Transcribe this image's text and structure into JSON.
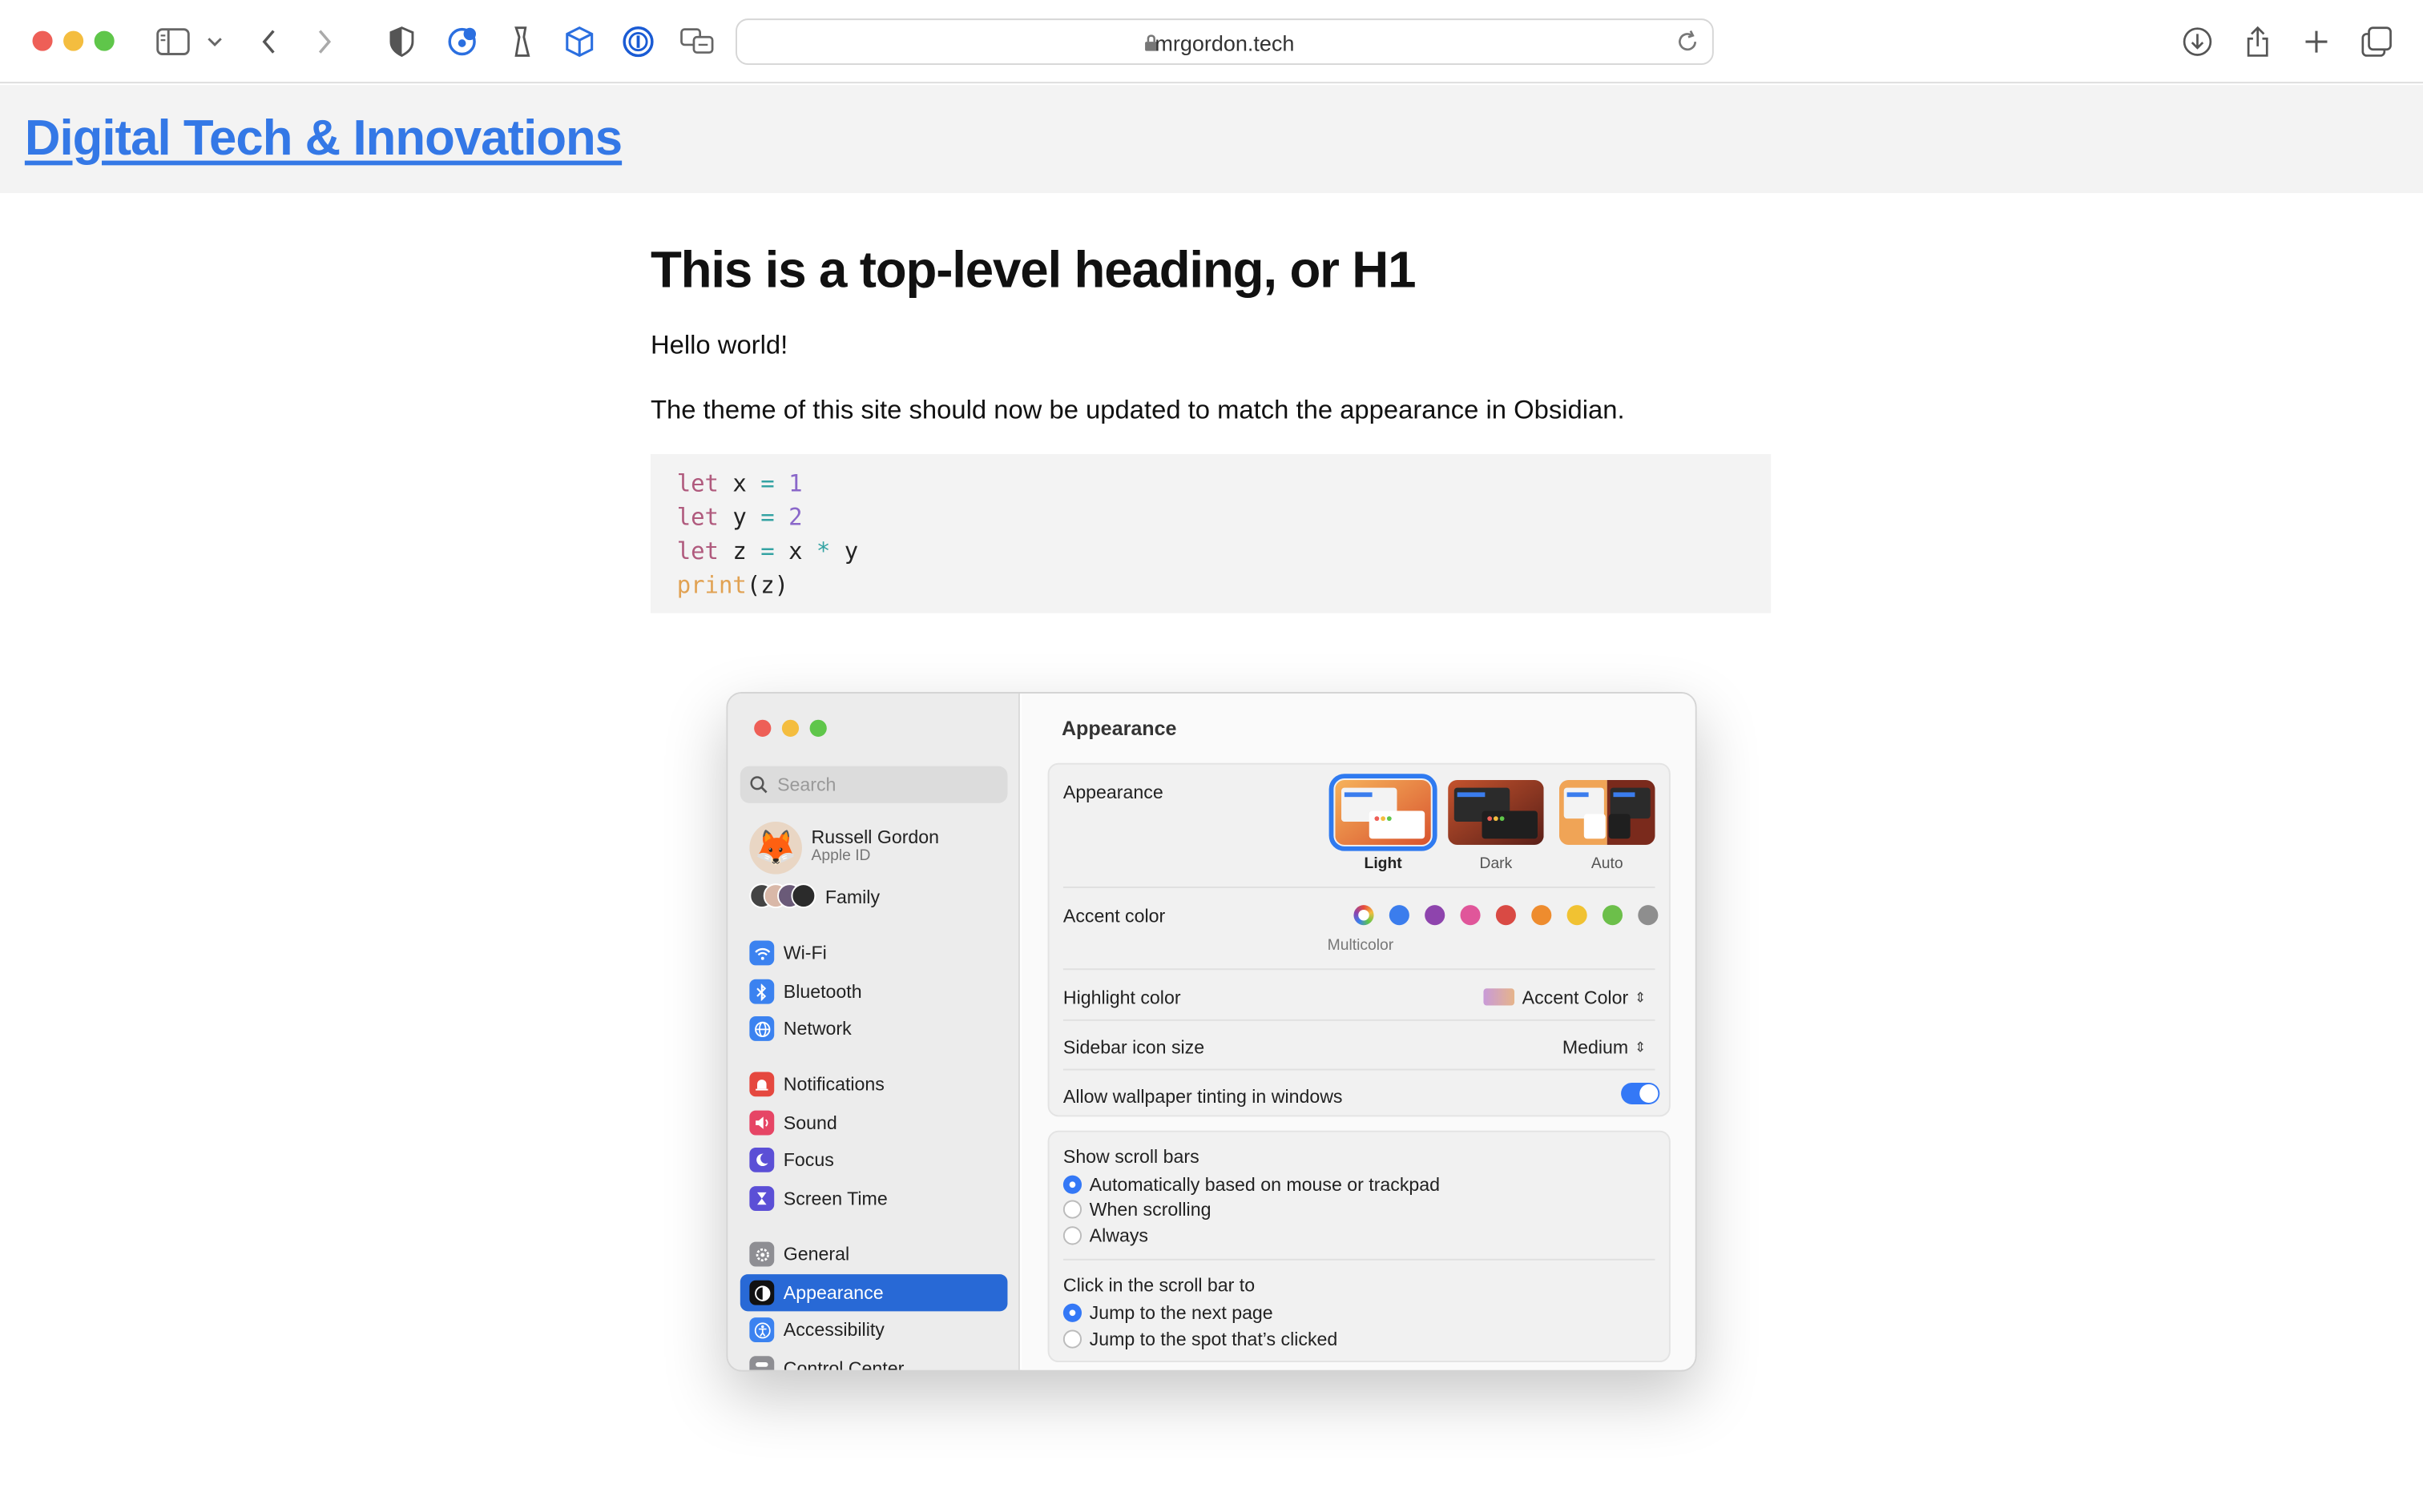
{
  "browser": {
    "url": "mrgordon.tech",
    "icons": [
      "sidebar-icon",
      "chevron-down-icon",
      "back-icon",
      "forward-icon",
      "shield-icon",
      "extension-badge-icon",
      "clear-icon",
      "package-icon",
      "password-manager-icon",
      "translate-icon",
      "lock-icon",
      "reload-icon",
      "download-icon",
      "share-icon",
      "new-tab-icon",
      "tab-overview-icon"
    ]
  },
  "site": {
    "title": "Digital Tech & Innovations",
    "heading": "This is a top-level heading, or H1",
    "paragraphs": [
      "Hello world!",
      "The theme of this site should now be updated to match the appearance in Obsidian."
    ],
    "code": {
      "line1": {
        "kw": "let",
        "var": "x",
        "op": "=",
        "val": "1"
      },
      "line2": {
        "kw": "let",
        "var": "y",
        "op": "=",
        "val": "2"
      },
      "line3": {
        "kw": "let",
        "var": "z",
        "op": "=",
        "a": "x",
        "mul": "*",
        "b": "y"
      },
      "line4": {
        "fn": "print",
        "open": "(",
        "arg": "z",
        "close": ")"
      }
    }
  },
  "settings": {
    "search_placeholder": "Search",
    "user": {
      "name": "Russell Gordon",
      "subtitle": "Apple ID"
    },
    "family": "Family",
    "sidebar_items": {
      "wifi": "Wi-Fi",
      "bluetooth": "Bluetooth",
      "network": "Network",
      "notifications": "Notifications",
      "sound": "Sound",
      "focus": "Focus",
      "screen_time": "Screen Time",
      "general": "General",
      "appearance": "Appearance",
      "accessibility": "Accessibility",
      "control_center": "Control Center"
    },
    "pane_title": "Appearance",
    "appearance_label": "Appearance",
    "appearance_options": {
      "light": "Light",
      "dark": "Dark",
      "auto": "Auto"
    },
    "appearance_selected": "Light",
    "accent_label": "Accent color",
    "accent_caption": "Multicolor",
    "accent_colors": [
      "#3b7ded",
      "#8e44ad",
      "#e0569a",
      "#d94a44",
      "#ee8c2e",
      "#f1c232",
      "#6cbf4a",
      "#8e8e8e"
    ],
    "highlight_label": "Highlight color",
    "highlight_value": "Accent Color",
    "sidebar_icon_label": "Sidebar icon size",
    "sidebar_icon_value": "Medium",
    "tinting_label": "Allow wallpaper tinting in windows",
    "tinting_on": true,
    "scroll_bars_label": "Show scroll bars",
    "scroll_bars_options": {
      "auto": "Automatically based on mouse or trackpad",
      "scrolling": "When scrolling",
      "always": "Always"
    },
    "click_scroll_label": "Click in the scroll bar to",
    "click_scroll_options": {
      "next_page": "Jump to the next page",
      "spot": "Jump to the spot that’s clicked"
    }
  },
  "colors": {
    "link": "#3478e6",
    "accent": "#3478f6",
    "sidebar_selected": "#2869d6"
  }
}
